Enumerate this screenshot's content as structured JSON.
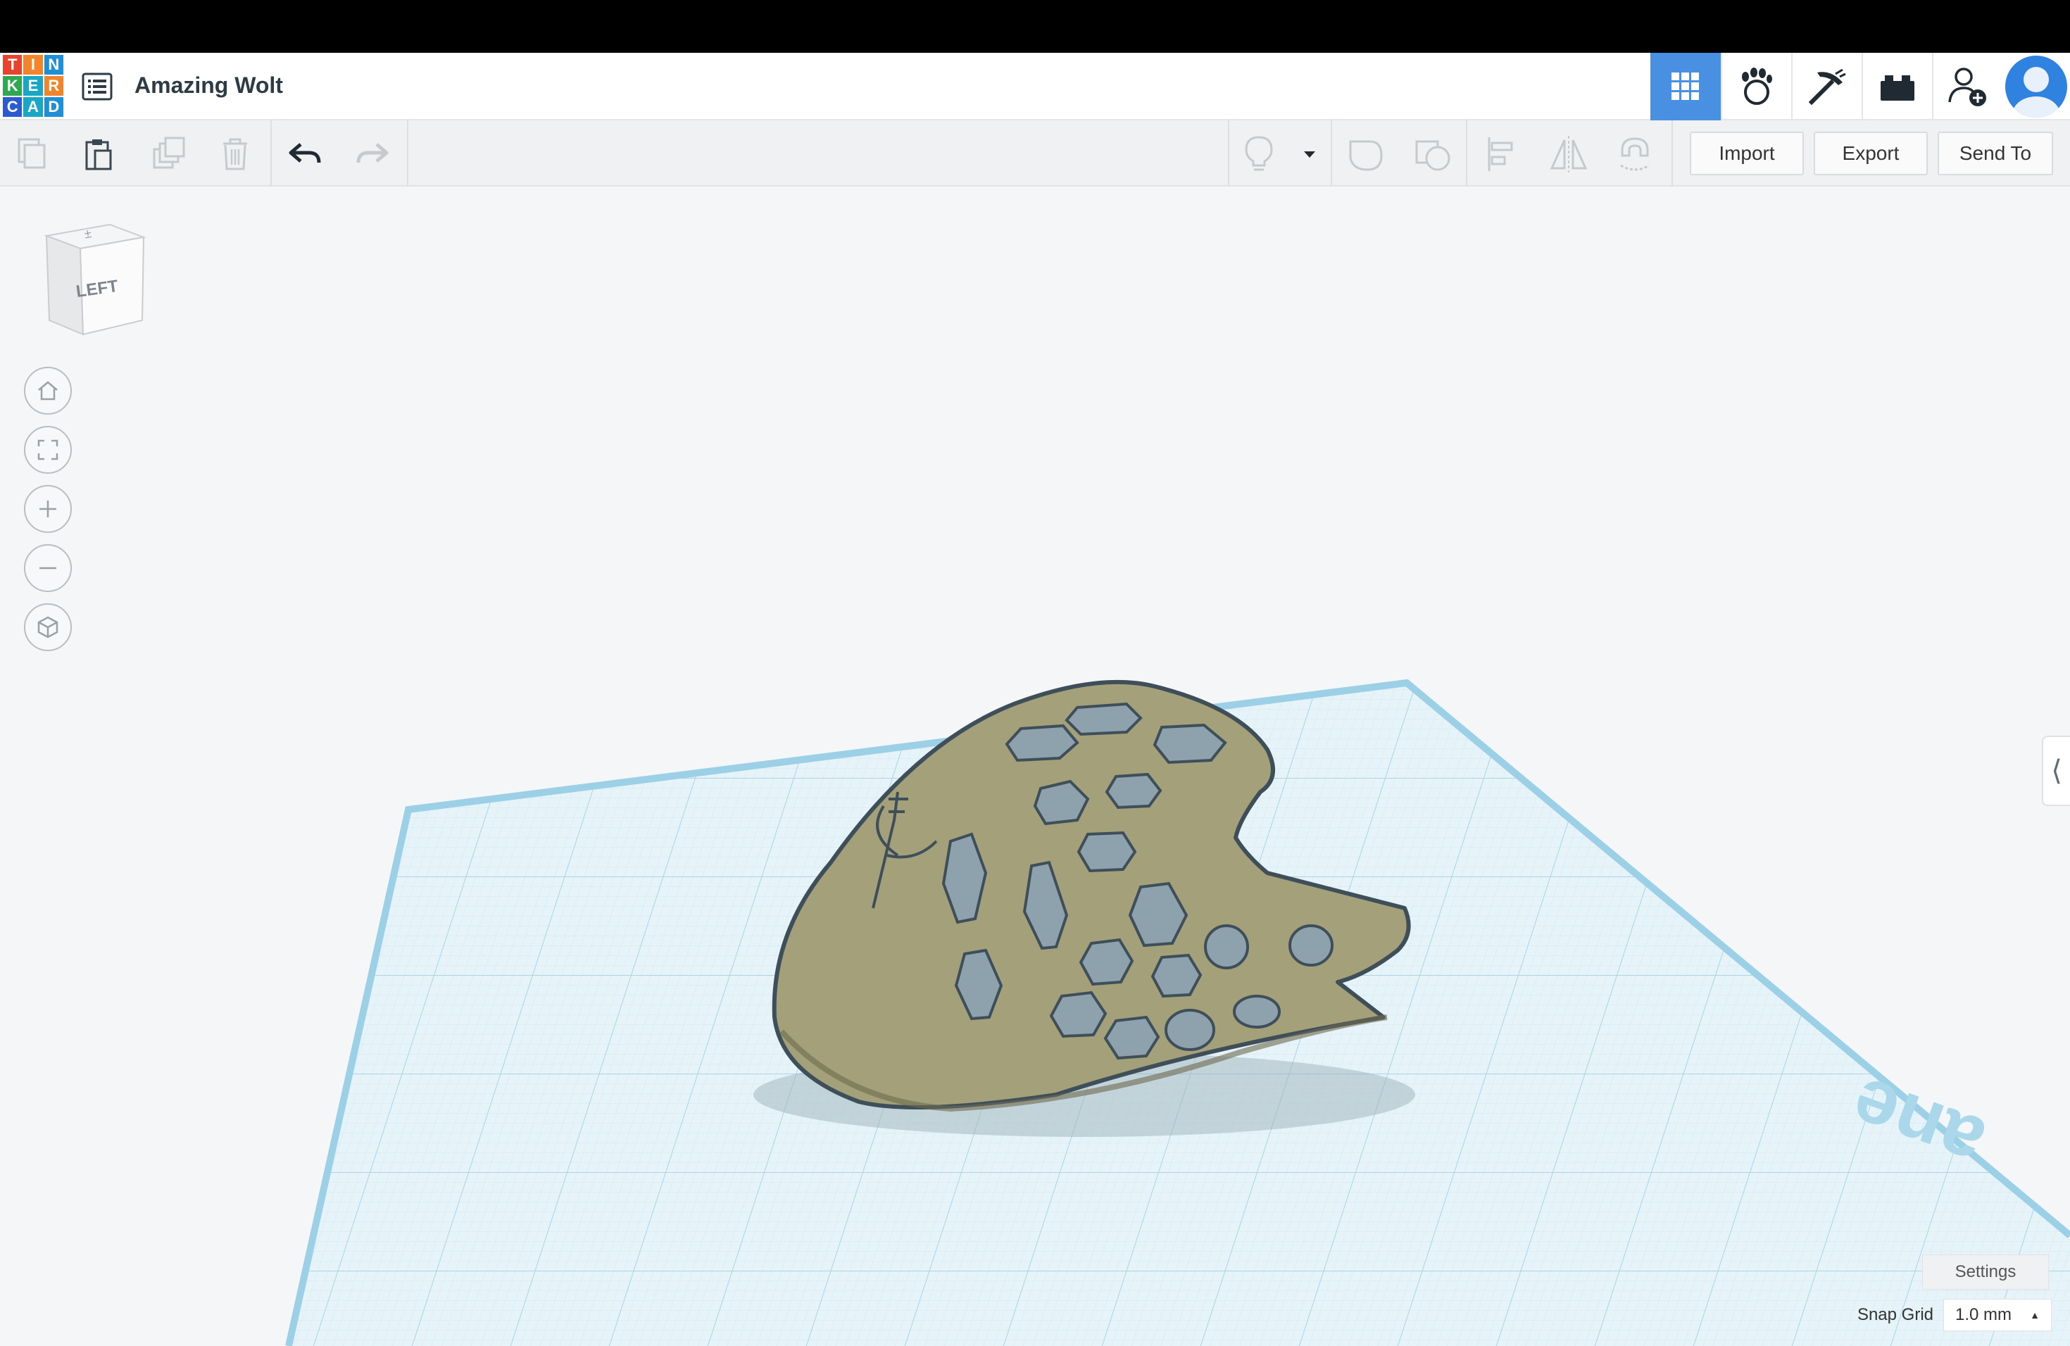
{
  "app": {
    "name": "Tinkercad",
    "logo_letters": [
      "T",
      "I",
      "N",
      "K",
      "E",
      "R",
      "C",
      "A",
      "D"
    ],
    "project_title": "Amazing Wolt"
  },
  "header": {
    "buttons": [
      {
        "icon": "grid-3d-icon",
        "active": true
      },
      {
        "icon": "codeblocks-paw-icon"
      },
      {
        "icon": "pickaxe-icon"
      },
      {
        "icon": "brick-icon"
      },
      {
        "icon": "add-user-icon"
      },
      {
        "icon": "avatar-icon"
      }
    ]
  },
  "toolbar": {
    "copy_icon": "copy-icon",
    "paste_icon": "paste-icon",
    "duplicate_icon": "duplicate-icon",
    "delete_icon": "trash-icon",
    "undo_icon": "undo-icon",
    "redo_icon": "redo-icon",
    "notes_icon": "lightbulb-icon",
    "notes_dropdown_icon": "caret-down-icon",
    "import_label": "Import",
    "export_label": "Export",
    "send_to_label": "Send To"
  },
  "viewcube": {
    "face_label": "LEFT"
  },
  "nav": [
    "home-icon",
    "fit-view-icon",
    "zoom-in-icon",
    "zoom-out-icon",
    "perspective-icon"
  ],
  "workplane": {
    "settings_label": "Settings",
    "snap_grid_label": "Snap Grid",
    "snap_grid_value": "1.0 mm"
  },
  "colors": {
    "accent": "#4a90e2",
    "model": "#a3a07a",
    "grid": "#cfe8f1"
  }
}
